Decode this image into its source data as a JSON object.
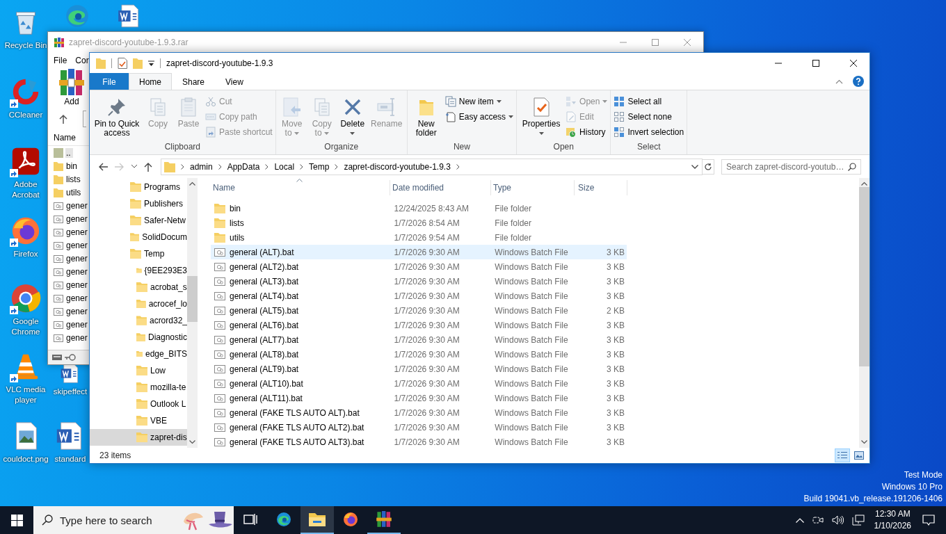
{
  "desktop": {
    "icons": [
      {
        "label": "Recycle Bin",
        "shortcut": false
      },
      {
        "shortcut": false
      },
      {
        "shortcut": false
      },
      {
        "label": "CCleaner",
        "shortcut": true
      },
      {
        "label": "Adobe Acrobat",
        "shortcut": true
      },
      {
        "label": "Firefox",
        "shortcut": true
      },
      {
        "label": "Google Chrome",
        "shortcut": true
      },
      {
        "label": "VLC media player",
        "shortcut": true
      },
      {
        "label": "skipeffect",
        "shortcut": false
      },
      {
        "label": "couldoct.png",
        "shortcut": false
      },
      {
        "label": "standard",
        "shortcut": false
      }
    ],
    "system_text": [
      "Test Mode",
      "Windows 10 Pro",
      "Build 19041.vb_release.191206-1406"
    ]
  },
  "archive_window": {
    "title": "zapret-discord-youtube-1.9.3.rar",
    "menu": [
      "File",
      "Cor"
    ],
    "toolbar": [
      "Add"
    ],
    "column": "Name",
    "rows": [
      {
        "name": "..",
        "kind": "parent",
        "selected": true
      },
      {
        "name": "bin",
        "kind": "folder",
        "selected": false
      },
      {
        "name": "lists",
        "kind": "folder",
        "selected": false
      },
      {
        "name": "utils",
        "kind": "folder",
        "selected": false
      },
      {
        "name": "gener",
        "kind": "batch",
        "selected": false
      },
      {
        "name": "gener",
        "kind": "batch",
        "selected": false
      },
      {
        "name": "gener",
        "kind": "batch",
        "selected": false
      },
      {
        "name": "gener",
        "kind": "batch",
        "selected": false
      },
      {
        "name": "gener",
        "kind": "batch",
        "selected": false
      },
      {
        "name": "gener",
        "kind": "batch",
        "selected": false
      },
      {
        "name": "gener",
        "kind": "batch",
        "selected": false
      },
      {
        "name": "gener",
        "kind": "batch",
        "selected": false
      },
      {
        "name": "gener",
        "kind": "batch",
        "selected": false
      },
      {
        "name": "gener",
        "kind": "batch",
        "selected": false
      },
      {
        "name": "gener",
        "kind": "batch",
        "selected": false
      }
    ]
  },
  "explorer": {
    "title": "zapret-discord-youtube-1.9.3",
    "tabs": [
      {
        "label": "File",
        "kind": "file",
        "selected": false
      },
      {
        "label": "Home",
        "kind": "tab",
        "selected": true
      },
      {
        "label": "Share",
        "kind": "tab",
        "selected": false
      },
      {
        "label": "View",
        "kind": "tab",
        "selected": false
      }
    ],
    "ribbon": [
      {
        "label": "Clipboard",
        "items": [
          {
            "label": "Pin to Quick access",
            "kind": "large",
            "disabled": false,
            "dropdown": false
          },
          {
            "label": "Copy",
            "kind": "large",
            "disabled": true,
            "dropdown": false
          },
          {
            "label": "Paste",
            "kind": "large",
            "disabled": true,
            "dropdown": false
          },
          {
            "label": "Cut",
            "kind": "small",
            "disabled": true,
            "dropdown": false
          },
          {
            "label": "Copy path",
            "kind": "small",
            "disabled": true,
            "dropdown": false
          },
          {
            "label": "Paste shortcut",
            "kind": "small",
            "disabled": true,
            "dropdown": false
          }
        ]
      },
      {
        "label": "Organize",
        "items": [
          {
            "label": "Move to",
            "kind": "large",
            "disabled": true,
            "dropdown": true
          },
          {
            "label": "Copy to",
            "kind": "large",
            "disabled": true,
            "dropdown": true
          },
          {
            "label": "Delete",
            "kind": "large",
            "disabled": false,
            "dropdown": true
          },
          {
            "label": "Rename",
            "kind": "large",
            "disabled": true,
            "dropdown": false
          }
        ]
      },
      {
        "label": "New",
        "items": [
          {
            "label": "New folder",
            "kind": "large",
            "disabled": false,
            "dropdown": false
          },
          {
            "label": "New item",
            "kind": "small",
            "disabled": false,
            "dropdown": true
          },
          {
            "label": "Easy access",
            "kind": "small",
            "disabled": false,
            "dropdown": true
          }
        ]
      },
      {
        "label": "Open",
        "items": [
          {
            "label": "Properties",
            "kind": "large",
            "disabled": false,
            "dropdown": true
          },
          {
            "label": "Open",
            "kind": "small",
            "disabled": true,
            "dropdown": true
          },
          {
            "label": "Edit",
            "kind": "small",
            "disabled": true,
            "dropdown": false
          },
          {
            "label": "History",
            "kind": "small",
            "disabled": false,
            "dropdown": false
          }
        ]
      },
      {
        "label": "Select",
        "items": [
          {
            "label": "Select all",
            "kind": "small",
            "disabled": false,
            "dropdown": false
          },
          {
            "label": "Select none",
            "kind": "small",
            "disabled": false,
            "dropdown": false
          },
          {
            "label": "Invert selection",
            "kind": "small",
            "disabled": false,
            "dropdown": false
          }
        ]
      }
    ],
    "address": [
      "admin",
      "AppData",
      "Local",
      "Temp",
      "zapret-discord-youtube-1.9.3"
    ],
    "search": {
      "placeholder": "Search zapret-discord-youtub…"
    },
    "nav": {
      "items": [
        {
          "label": "Programs",
          "selected": false
        },
        {
          "label": "Publishers",
          "selected": false
        },
        {
          "label": "Safer-Netw",
          "selected": false
        },
        {
          "label": "SolidDocum",
          "selected": false
        },
        {
          "label": "Temp",
          "selected": false,
          "children": [
            {
              "label": "{9EE293E3",
              "selected": false
            },
            {
              "label": "acrobat_s",
              "selected": false
            },
            {
              "label": "acrocef_lo",
              "selected": false
            },
            {
              "label": "acrord32_",
              "selected": false
            },
            {
              "label": "Diagnostic",
              "selected": false
            },
            {
              "label": "edge_BITS",
              "selected": false
            },
            {
              "label": "Low",
              "selected": false
            },
            {
              "label": "mozilla-te",
              "selected": false
            },
            {
              "label": "Outlook L",
              "selected": false
            },
            {
              "label": "VBE",
              "selected": false
            },
            {
              "label": "zapret-dis",
              "selected": true
            }
          ]
        }
      ]
    },
    "columns": [
      {
        "label": "Name",
        "sorted": true
      },
      {
        "label": "Date modified",
        "sorted": false
      },
      {
        "label": "Type",
        "sorted": false
      },
      {
        "label": "Size",
        "sorted": false
      }
    ],
    "rows": [
      {
        "name": "bin",
        "date": "12/24/2025 8:43 AM",
        "type": "File folder",
        "kind": "folder",
        "selected": false,
        "hovered": false
      },
      {
        "name": "lists",
        "date": "1/7/2026 8:54 AM",
        "type": "File folder",
        "kind": "folder",
        "selected": false,
        "hovered": false
      },
      {
        "name": "utils",
        "date": "1/7/2026 9:54 AM",
        "type": "File folder",
        "kind": "folder",
        "selected": false,
        "hovered": false
      },
      {
        "name": "general (ALT).bat",
        "date": "1/7/2026 9:30 AM",
        "type": "Windows Batch File",
        "size": "3 KB",
        "kind": "batch",
        "selected": false,
        "hovered": true
      },
      {
        "name": "general (ALT2).bat",
        "date": "1/7/2026 9:30 AM",
        "type": "Windows Batch File",
        "size": "3 KB",
        "kind": "batch",
        "selected": false,
        "hovered": false
      },
      {
        "name": "general (ALT3).bat",
        "date": "1/7/2026 9:30 AM",
        "type": "Windows Batch File",
        "size": "3 KB",
        "kind": "batch",
        "selected": false,
        "hovered": false
      },
      {
        "name": "general (ALT4).bat",
        "date": "1/7/2026 9:30 AM",
        "type": "Windows Batch File",
        "size": "3 KB",
        "kind": "batch",
        "selected": false,
        "hovered": false
      },
      {
        "name": "general (ALT5).bat",
        "date": "1/7/2026 9:30 AM",
        "type": "Windows Batch File",
        "size": "2 KB",
        "kind": "batch",
        "selected": false,
        "hovered": false
      },
      {
        "name": "general (ALT6).bat",
        "date": "1/7/2026 9:30 AM",
        "type": "Windows Batch File",
        "size": "3 KB",
        "kind": "batch",
        "selected": false,
        "hovered": false
      },
      {
        "name": "general (ALT7).bat",
        "date": "1/7/2026 9:30 AM",
        "type": "Windows Batch File",
        "size": "3 KB",
        "kind": "batch",
        "selected": false,
        "hovered": false
      },
      {
        "name": "general (ALT8).bat",
        "date": "1/7/2026 9:30 AM",
        "type": "Windows Batch File",
        "size": "3 KB",
        "kind": "batch",
        "selected": false,
        "hovered": false
      },
      {
        "name": "general (ALT9).bat",
        "date": "1/7/2026 9:30 AM",
        "type": "Windows Batch File",
        "size": "3 KB",
        "kind": "batch",
        "selected": false,
        "hovered": false
      },
      {
        "name": "general (ALT10).bat",
        "date": "1/7/2026 9:30 AM",
        "type": "Windows Batch File",
        "size": "3 KB",
        "kind": "batch",
        "selected": false,
        "hovered": false
      },
      {
        "name": "general (ALT11).bat",
        "date": "1/7/2026 9:30 AM",
        "type": "Windows Batch File",
        "size": "3 KB",
        "kind": "batch",
        "selected": false,
        "hovered": false
      },
      {
        "name": "general (FAKE TLS AUTO ALT).bat",
        "date": "1/7/2026 9:30 AM",
        "type": "Windows Batch File",
        "size": "3 KB",
        "kind": "batch",
        "selected": false,
        "hovered": false
      },
      {
        "name": "general (FAKE TLS AUTO ALT2).bat",
        "date": "1/7/2026 9:30 AM",
        "type": "Windows Batch File",
        "size": "3 KB",
        "kind": "batch",
        "selected": false,
        "hovered": false
      },
      {
        "name": "general (FAKE TLS AUTO ALT3).bat",
        "date": "1/7/2026 9:30 AM",
        "type": "Windows Batch File",
        "size": "3 KB",
        "kind": "batch",
        "selected": false,
        "hovered": false
      }
    ],
    "status": "23 items",
    "views": [
      {
        "selected": true
      },
      {
        "selected": false
      }
    ]
  },
  "taskbar": {
    "search": {
      "placeholder": "Type here to search"
    },
    "apps": [
      {
        "open": false,
        "active": false
      },
      {
        "open": false,
        "active": false
      },
      {
        "open": true,
        "active": true
      },
      {
        "open": false,
        "active": false
      },
      {
        "open": true,
        "active": false
      }
    ],
    "time": "12:30 AM",
    "date": "1/10/2026"
  }
}
